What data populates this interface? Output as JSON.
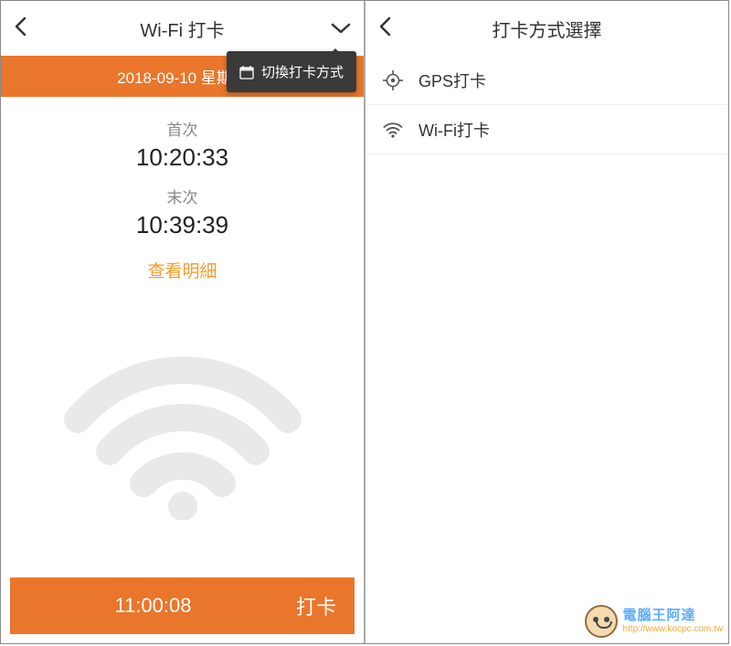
{
  "left": {
    "header": {
      "title": "Wi-Fi 打卡"
    },
    "tooltip": "切換打卡方式",
    "date": "2018-09-10 星期一",
    "first": {
      "label": "首次",
      "time": "10:20:33"
    },
    "last": {
      "label": "末次",
      "time": "10:39:39"
    },
    "view_detail": "查看明細",
    "bottom": {
      "time": "11:00:08",
      "action": "打卡"
    }
  },
  "right": {
    "header": {
      "title": "打卡方式選擇"
    },
    "options": {
      "gps": "GPS打卡",
      "wifi": "Wi-Fi打卡"
    }
  },
  "watermark": {
    "text": "電腦王阿達",
    "url": "http://www.kocpc.com.tw"
  }
}
